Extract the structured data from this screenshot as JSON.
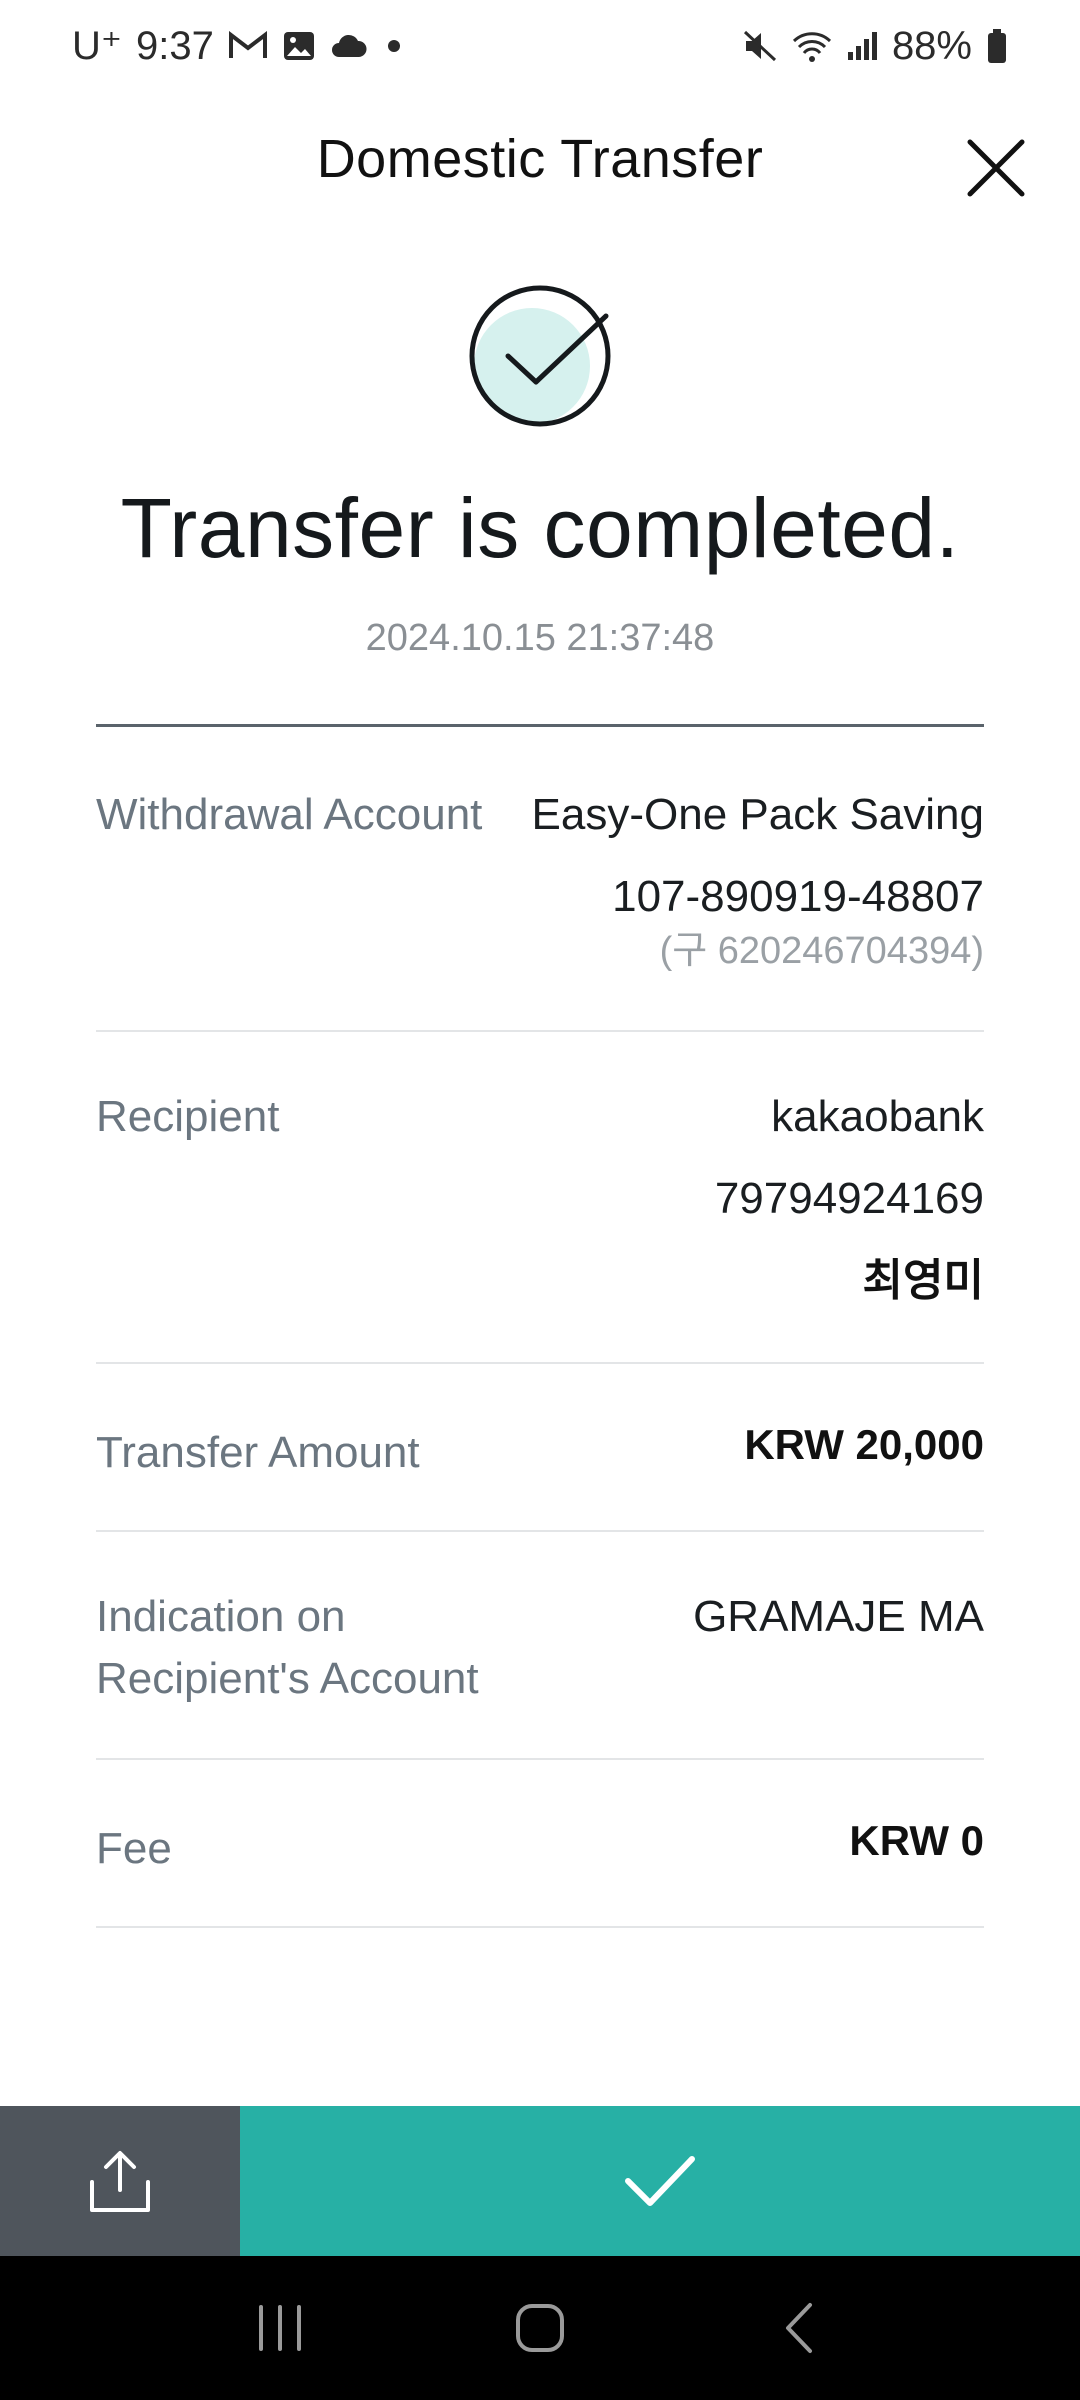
{
  "status_bar": {
    "carrier": "U⁺",
    "time": "9:37",
    "battery": "88%",
    "left_icons": [
      "gmail-icon",
      "gallery-icon",
      "cloud-icon",
      "dot-icon"
    ],
    "right_icons": [
      "mute-icon",
      "wifi-icon",
      "signal-icon",
      "battery-icon"
    ]
  },
  "header": {
    "title": "Domestic Transfer"
  },
  "result": {
    "headline": "Transfer is completed.",
    "timestamp": "2024.10.15 21:37:48"
  },
  "details": {
    "withdrawal": {
      "label": "Withdrawal Account",
      "product": "Easy-One Pack Saving",
      "account": "107-890919-48807",
      "old_account": "(구 620246704394)"
    },
    "recipient": {
      "label": "Recipient",
      "bank": "kakaobank",
      "account": "79794924169",
      "name": "최영미"
    },
    "amount": {
      "label": "Transfer Amount",
      "value": "KRW 20,000"
    },
    "indication": {
      "label_line1": "Indication on",
      "label_line2": "Recipient's Account",
      "value": "GRAMAJE MA"
    },
    "fee": {
      "label": "Fee",
      "value": "KRW 0"
    }
  },
  "actions": {
    "share_icon": "share-icon",
    "confirm_icon": "check-icon"
  },
  "colors": {
    "accent": "#27b0a5",
    "accent_light": "#d6f1ee",
    "share_bg": "#4f555c"
  }
}
